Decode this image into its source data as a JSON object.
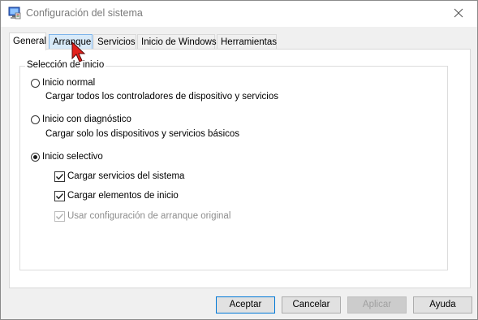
{
  "window": {
    "title": "Configuración del sistema",
    "app_icon": "msconfig-icon",
    "close_icon": "close-icon"
  },
  "tabs": [
    {
      "label": "General",
      "active": true
    },
    {
      "label": "Arranque",
      "hover": true
    },
    {
      "label": "Servicios"
    },
    {
      "label": "Inicio de Windows"
    },
    {
      "label": "Herramientas"
    }
  ],
  "startup_group": {
    "legend": "Selección de inicio",
    "options": [
      {
        "label": "Inicio normal",
        "description": "Cargar todos los controladores de dispositivo y servicios",
        "checked": false
      },
      {
        "label": "Inicio con diagnóstico",
        "description": "Cargar solo los dispositivos y servicios básicos",
        "checked": false
      },
      {
        "label": "Inicio selectivo",
        "checked": true
      }
    ],
    "selective_checks": [
      {
        "label": "Cargar servicios del sistema",
        "checked": true,
        "enabled": true
      },
      {
        "label": "Cargar elementos de inicio",
        "checked": true,
        "enabled": true
      },
      {
        "label": "Usar configuración de arranque original",
        "checked": true,
        "enabled": false
      }
    ]
  },
  "buttons": {
    "ok": "Aceptar",
    "cancel": "Cancelar",
    "apply": "Aplicar",
    "help": "Ayuda"
  },
  "colors": {
    "accent": "#0078d7",
    "cursor_red": "#e2201b",
    "hover_tab": "#d8eaf9"
  }
}
